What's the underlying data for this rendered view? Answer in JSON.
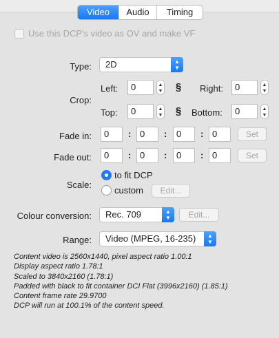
{
  "tabs": [
    {
      "label": "Video",
      "active": true
    },
    {
      "label": "Audio",
      "active": false
    },
    {
      "label": "Timing",
      "active": false
    }
  ],
  "use_ov": {
    "label": "Use this DCP's video as OV and make VF",
    "checked": false,
    "enabled": false
  },
  "type": {
    "label": "Type:",
    "value": "2D"
  },
  "crop": {
    "label": "Crop:",
    "left_label": "Left:",
    "left": "0",
    "right_label": "Right:",
    "right": "0",
    "top_label": "Top:",
    "top": "0",
    "bottom_label": "Bottom:",
    "bottom": "0",
    "link_icon": "link-icon"
  },
  "fade_in": {
    "label": "Fade in:",
    "values": [
      "0",
      "0",
      "0",
      "0"
    ],
    "set_label": "Set"
  },
  "fade_out": {
    "label": "Fade out:",
    "values": [
      "0",
      "0",
      "0",
      "0"
    ],
    "set_label": "Set"
  },
  "scale": {
    "label": "Scale:",
    "fit_label": "to fit DCP",
    "custom_label": "custom",
    "edit_label": "Edit...",
    "selected": "to fit DCP"
  },
  "colour": {
    "label": "Colour conversion:",
    "value": "Rec. 709",
    "edit_label": "Edit..."
  },
  "range": {
    "label": "Range:",
    "value": "Video (MPEG, 16-235)"
  },
  "info_lines": [
    "Content video is 2560x1440, pixel aspect ratio 1.00:1",
    "Display aspect ratio 1.78:1",
    "Scaled to 3840x2160 (1.78:1)",
    "Padded with black to fit container DCI Flat (3996x2160) (1.85:1)",
    "Content frame rate 29.9700",
    "DCP will run at 100.1% of the content speed."
  ],
  "colors": {
    "accent": "#1877f2",
    "panel": "#e3e3e3"
  }
}
